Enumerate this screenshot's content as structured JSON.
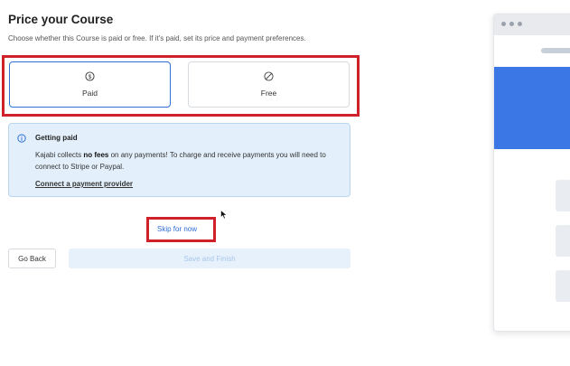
{
  "page": {
    "title": "Price your Course",
    "subtitle": "Choose whether this Course is paid or free. If it's paid, set its price and payment preferences."
  },
  "options": [
    {
      "label": "Paid",
      "icon": "dollar-circle-icon",
      "selected": true
    },
    {
      "label": "Free",
      "icon": "slash-circle-icon",
      "selected": false
    }
  ],
  "info": {
    "heading": "Getting paid",
    "body_prefix": "Kajabi collects ",
    "body_bold": "no fees",
    "body_suffix": " on any payments! To charge and receive payments you will need to connect to Stripe or Paypal.",
    "link": "Connect a payment provider",
    "icon": "info-icon"
  },
  "actions": {
    "skip": "Skip for now",
    "back": "Go Back",
    "save": "Save and Finish"
  },
  "colors": {
    "accent": "#2f6fd6",
    "highlight": "#d0212b",
    "info_bg": "#e3f0fb",
    "preview_hero": "#3b78e6"
  }
}
